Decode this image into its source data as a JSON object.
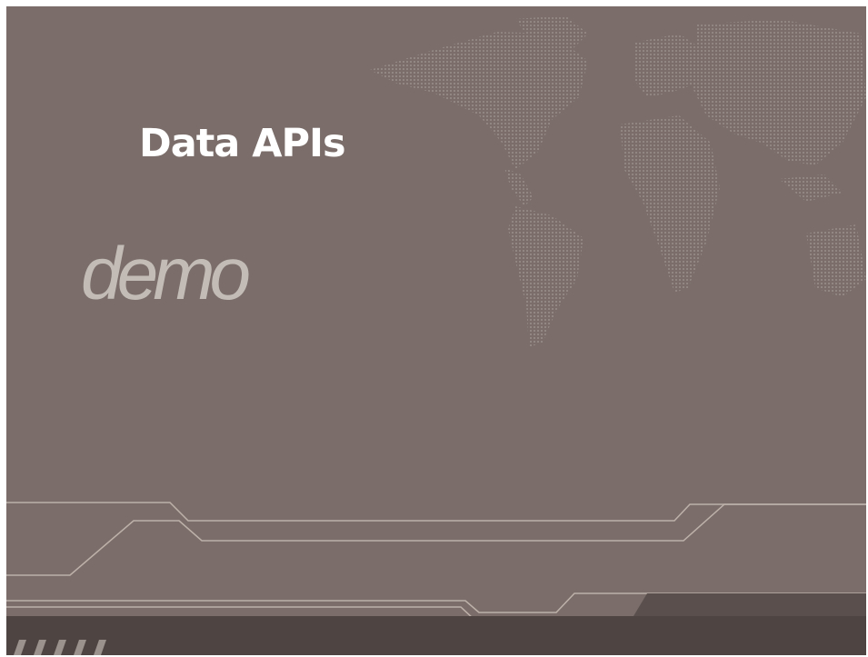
{
  "slide": {
    "title": "Data APIs",
    "subtitle": "demo"
  },
  "colors": {
    "background": "#7b6e6a",
    "title_text": "#ffffff",
    "subtitle_text": "#c3bcb6",
    "footer_bar": "#4e4441",
    "circuit_line": "#c9bdb6"
  },
  "decorations": {
    "background_graphic": "world-map-dot-matrix",
    "footer_graphic": "circuit-lines"
  }
}
